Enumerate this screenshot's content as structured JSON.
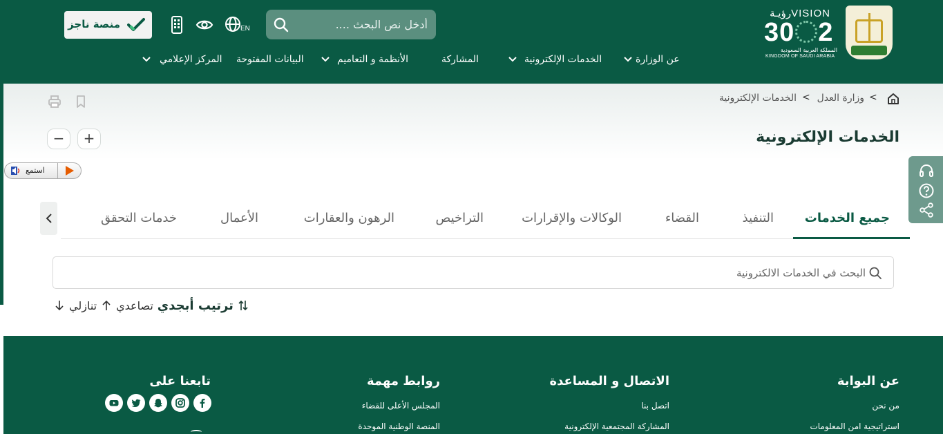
{
  "header": {
    "vision": {
      "latin": "VISION",
      "arabic": "رؤيـة",
      "year": "2030",
      "kingdom_ar": "المملكة العربية السعودية",
      "kingdom_en": "KINGDOM OF SAUDI ARABIA"
    },
    "search_placeholder": "أدخل نص البحث ....",
    "lang_label": "EN",
    "najez_label": "منصة ناجز",
    "nav": [
      {
        "label": "عن الوزارة",
        "has_menu": true
      },
      {
        "label": "الخدمات الإلكترونية",
        "has_menu": true
      },
      {
        "label": "المشاركة",
        "has_menu": false
      },
      {
        "label": "الأنظمة و التعاميم",
        "has_menu": true
      },
      {
        "label": "البيانات المفتوحة",
        "has_menu": false
      },
      {
        "label": "المركز الإعلامي",
        "has_menu": true
      }
    ]
  },
  "breadcrumb": {
    "items": [
      "وزارة العدل",
      "الخدمات الإلكترونية"
    ],
    "separator": ">"
  },
  "page_title": "الخدمات الإلكترونية",
  "zoom": {
    "plus": "+",
    "minus": "−"
  },
  "listen_label": "استمع",
  "tabs": [
    {
      "label": "جميع الخدمات",
      "active": true
    },
    {
      "label": "التنفيذ",
      "active": false
    },
    {
      "label": "القضاء",
      "active": false
    },
    {
      "label": "الوكالات والإقرارات",
      "active": false
    },
    {
      "label": "التراخيص",
      "active": false
    },
    {
      "label": "الرهون والعقارات",
      "active": false
    },
    {
      "label": "الأعمال",
      "active": false
    },
    {
      "label": "خدمات التحقق",
      "active": false
    }
  ],
  "service_search_placeholder": "البحث في الخدمات الالكترونية",
  "sort": {
    "title": "ترتيب أبجدي",
    "ascending": "تصاعدي",
    "descending": "تنازلي"
  },
  "footer": {
    "about": {
      "title": "عن البوابة",
      "links": [
        "من نحن",
        "استراتيجية امن المعلومات"
      ]
    },
    "contact": {
      "title": "الاتصال و المساعدة",
      "links": [
        "اتصل بنا",
        "المشاركة المجتمعية الإلكترونية"
      ]
    },
    "links": {
      "title": "روابط مهمة",
      "links": [
        "المجلس الأعلى للقضاء",
        "المنصة الوطنية الموحدة"
      ]
    },
    "follow": {
      "title": "تابعنا على"
    },
    "social": [
      "facebook-icon",
      "instagram-icon",
      "snapchat-icon",
      "twitter-icon",
      "youtube-icon"
    ]
  },
  "colors": {
    "brand_green": "#0a5a44",
    "search_green": "#5b8f7f",
    "side_tools": "#6e9a8d"
  }
}
